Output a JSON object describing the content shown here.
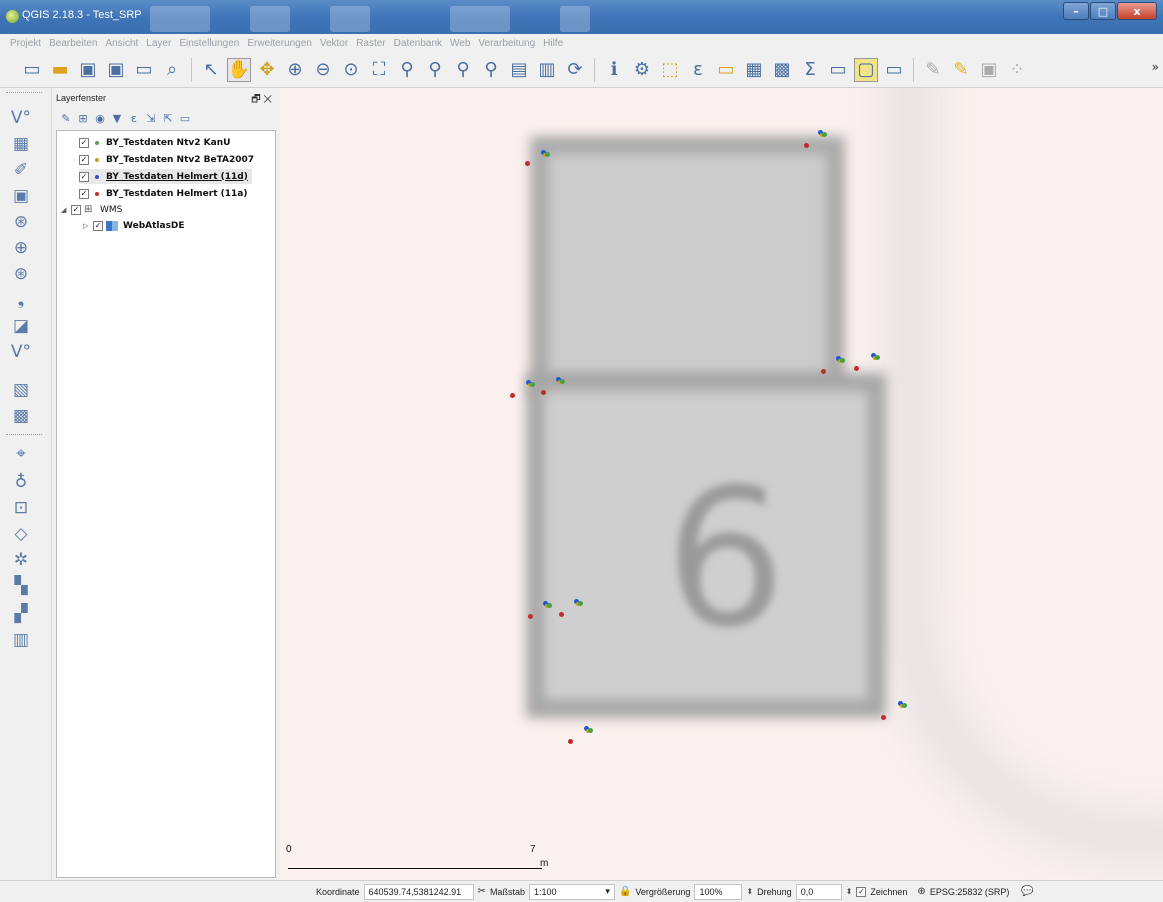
{
  "window": {
    "title": "QGIS 2.18.3 - Test_SRP",
    "controls": [
      "–",
      "□",
      "x"
    ]
  },
  "menu": [
    "Projekt",
    "Bearbeiten",
    "Ansicht",
    "Layer",
    "Einstellungen",
    "Erweiterungen",
    "Vektor",
    "Raster",
    "Datenbank",
    "Web",
    "Verarbeitung",
    "Hilfe"
  ],
  "toolbar": {
    "more": "»"
  },
  "layer_panel": {
    "title": "Layerfenster",
    "layers": [
      {
        "name": "BY_Testdaten Ntv2 KanU",
        "checked": "✓",
        "dot_color": "#5aa050"
      },
      {
        "name": "BY_Testdaten Ntv2 BeTA2007",
        "checked": "✓",
        "dot_color": "#c0a020"
      },
      {
        "name": "BY_Testdaten Helmert (11d)",
        "checked": "✓",
        "dot_color": "#3050c0"
      },
      {
        "name": "BY_Testdaten Helmert (11a)",
        "checked": "✓",
        "dot_color": "#c03030"
      }
    ],
    "group": {
      "name": "WMS",
      "checked": "✓",
      "child": {
        "name": "WebAtlasDE",
        "checked": "✓"
      }
    }
  },
  "map": {
    "house_number": "6",
    "scale": {
      "start": "0",
      "end": "7",
      "unit": "m"
    }
  },
  "status": {
    "coord_label": "Koordinate",
    "coord_value": "640539.74,5381242.91",
    "scale_label": "Maßstab",
    "scale_value": "1:100",
    "magnify_label": "Vergrößerung",
    "magnify_value": "100%",
    "rotation_label": "Drehung",
    "rotation_value": "0,0",
    "render_label": "Zeichnen",
    "render_checked": "✓",
    "crs": "EPSG:25832 (SRP)"
  },
  "colors": {
    "titlebar": "#3f75b8",
    "point_red": "#c02b2b",
    "point_blue": "#2255d6",
    "point_green": "#44a044"
  }
}
